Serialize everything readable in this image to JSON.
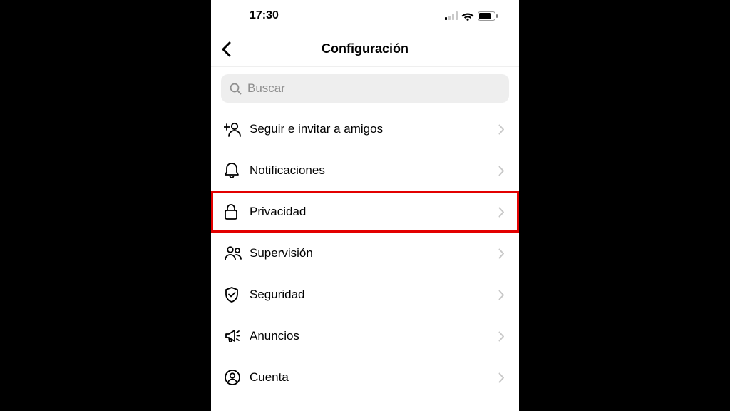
{
  "status": {
    "time": "17:30"
  },
  "header": {
    "title": "Configuración"
  },
  "search": {
    "placeholder": "Buscar"
  },
  "menu": {
    "items": [
      {
        "label": "Seguir e invitar a amigos"
      },
      {
        "label": "Notificaciones"
      },
      {
        "label": "Privacidad"
      },
      {
        "label": "Supervisión"
      },
      {
        "label": "Seguridad"
      },
      {
        "label": "Anuncios"
      },
      {
        "label": "Cuenta"
      }
    ],
    "highlighted_index": 2
  }
}
